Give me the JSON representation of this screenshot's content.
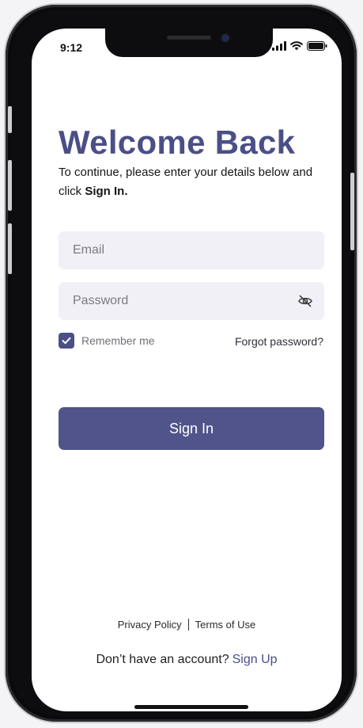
{
  "status_bar": {
    "time": "9:12",
    "icons": [
      "signal-icon",
      "wifi-icon",
      "battery-icon"
    ]
  },
  "header": {
    "title": "Welcome Back",
    "subtitle_prefix": "To continue, please enter your details below and click ",
    "subtitle_emphasis": "Sign In."
  },
  "form": {
    "email": {
      "placeholder": "Email",
      "value": ""
    },
    "password": {
      "placeholder": "Password",
      "value": "",
      "toggle_icon": "eye-off-icon"
    },
    "remember_me": {
      "label": "Remember me",
      "checked": true
    },
    "forgot_label": "Forgot password?",
    "submit_label": "Sign In"
  },
  "footer": {
    "privacy_label": "Privacy Policy",
    "terms_label": "Terms of Use",
    "no_account_text": "Don’t have an account?",
    "signup_label": "Sign Up"
  },
  "colors": {
    "brand": "#4b4f86",
    "button": "#51548a",
    "input_bg": "#f1f0f6"
  }
}
